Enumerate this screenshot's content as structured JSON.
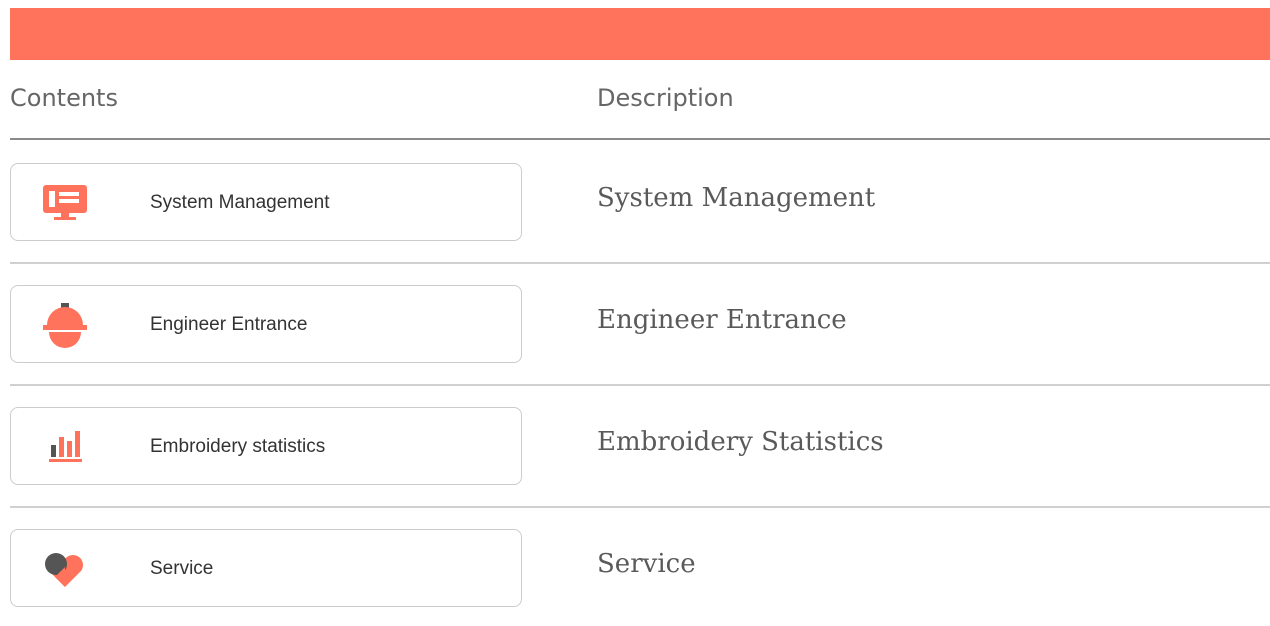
{
  "header": {
    "contents_label": "Contents",
    "description_label": "Description"
  },
  "rows": [
    {
      "label": "System Management",
      "description": "System Management",
      "icon": "monitor-icon"
    },
    {
      "label": "Engineer Entrance",
      "description": "Engineer Entrance",
      "icon": "hard-hat-icon"
    },
    {
      "label": "Embroidery statistics",
      "description": "Embroidery Statistics",
      "icon": "bar-chart-icon"
    },
    {
      "label": "Service",
      "description": "Service",
      "icon": "heart-icon"
    }
  ],
  "colors": {
    "accent": "#ff735c",
    "icon_dark": "#555555",
    "header_rule": "#8a8a8a",
    "row_rule": "#d0d0d0"
  }
}
